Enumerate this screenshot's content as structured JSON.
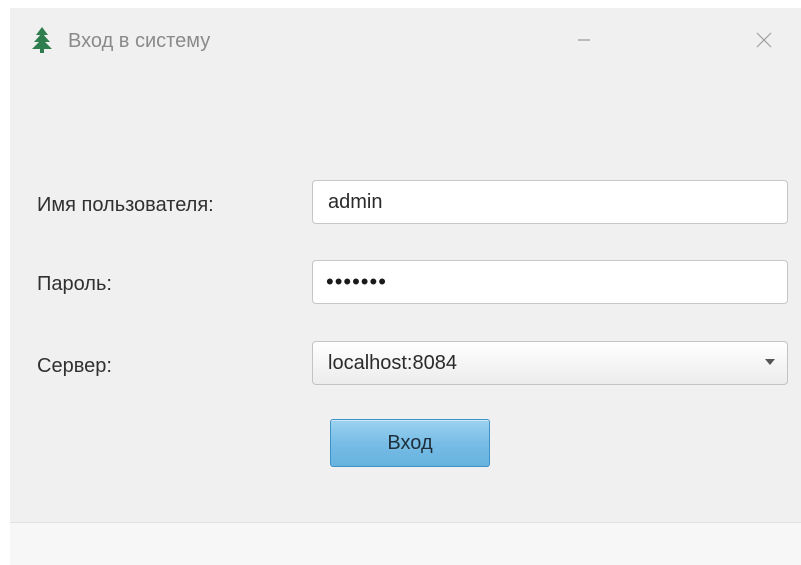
{
  "window": {
    "title": "Вход в систему",
    "icon": "tree-icon",
    "controls": {
      "minimize_icon": "minimize-icon",
      "close_icon": "close-icon"
    }
  },
  "form": {
    "username_label": "Имя пользователя:",
    "username_value": "admin",
    "password_label": "Пароль:",
    "password_masked": "•••••••",
    "server_label": "Сервер:",
    "server_selected": "localhost:8084",
    "submit_label": "Вход"
  },
  "colors": {
    "accent_button": "#78bde6",
    "icon_green": "#2e7d4f"
  }
}
